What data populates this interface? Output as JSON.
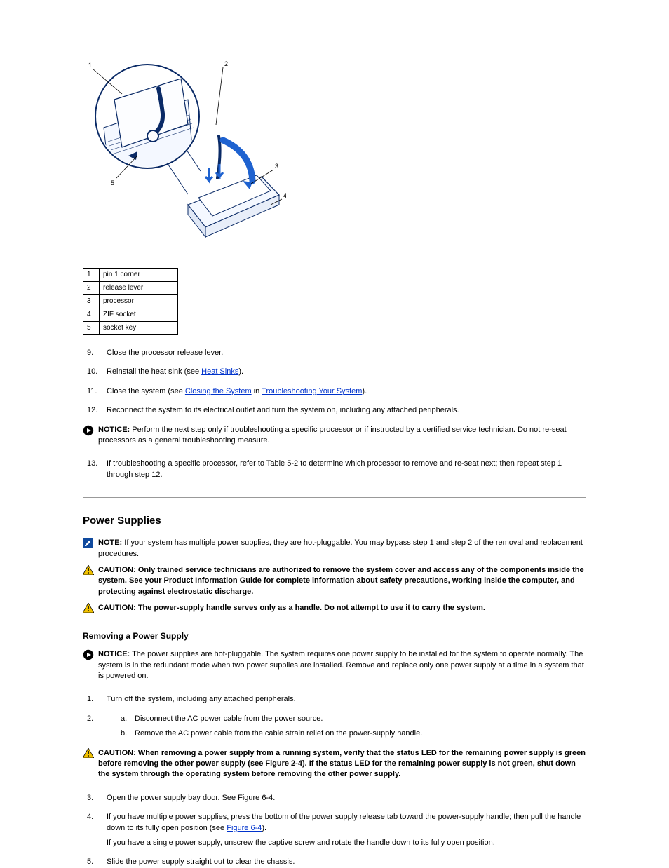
{
  "diagram": {
    "callouts": {
      "c1": "1",
      "c2": "2",
      "c3": "3",
      "c4": "4",
      "c5": "5"
    }
  },
  "legend": {
    "r1_num": "1",
    "r1_label": "pin 1 corner",
    "r2_num": "2",
    "r2_label": "release lever",
    "r3_num": "3",
    "r3_label": "processor",
    "r4_num": "4",
    "r4_label": "ZIF socket",
    "r5_num": "5",
    "r5_label": "socket key"
  },
  "steps_top": {
    "s9": "Close the processor release lever.",
    "s10_pre": "Reinstall the heat sink (see ",
    "s10_link": "Heat Sinks",
    "s10_post": ").",
    "s11_pre": "Close the system (see ",
    "s11_link": "Closing the System",
    "s11_post": " in ",
    "s11_link2": "Troubleshooting Your System",
    "s11_post2": ").",
    "s12": "Reconnect the system to its electrical outlet and turn the system on, including any attached peripherals.",
    "notice_lead": "NOTICE:",
    "notice_body": " Perform the next step only if troubleshooting a specific processor or if instructed by a certified service technician. Do not re-seat processors as a general troubleshooting measure.",
    "s13": "If troubleshooting a specific processor, refer to Table 5-2 to determine which processor to remove and re-seat next; then repeat step 1 through step 12."
  },
  "section": {
    "title": "Power Supplies",
    "note_lead": "NOTE:",
    "note_body": " If your system has multiple power supplies, they are hot-pluggable. You may bypass step 1 and step 2 of the removal and replacement procedures.",
    "caution1_lead": "CAUTION:",
    "caution1_body": " Only trained service technicians are authorized to remove the system cover and access any of the components inside the system. See your Product Information Guide for complete information about safety precautions, working inside the computer, and protecting against electrostatic discharge.",
    "caution2_lead": "CAUTION:",
    "caution2_body": " The power-supply handle serves only as a handle. Do not attempt to use it to carry the system."
  },
  "remove": {
    "head": "Removing a Power Supply",
    "notice_lead": "NOTICE:",
    "notice_body": " The power supplies are hot-pluggable. The system requires one power supply to be installed for the system to operate normally. The system is in the redundant mode when two power supplies are installed. Remove and replace only one power supply at a time in a system that is powered on.",
    "s1": "Turn off the system, including any attached peripherals.",
    "s2_a": "Disconnect the AC power cable from the power source.",
    "s2_b": "Remove the AC power cable from the cable strain relief on the power-supply handle.",
    "caution_lead": "CAUTION:",
    "caution_body": " When removing a power supply from a running system, verify that the status LED for the remaining power supply is green before removing the other power supply (see Figure 2-4). If the status LED for the remaining power supply is not green, shut down the system through the operating system before removing the other power supply.",
    "s3": "Open the power supply bay door. See Figure 6-4.",
    "s4_pre": "If you have multiple power supplies, press the bottom of the power supply release tab toward the power-supply handle; then pull the handle down to its fully open position (see ",
    "s4_link": "Figure 6-4",
    "s4_post": ").",
    "s4_note": "If you have a single power supply, unscrew the captive screw and rotate the handle down to its fully open position.",
    "s5": "Slide the power supply straight out to clear the chassis."
  }
}
